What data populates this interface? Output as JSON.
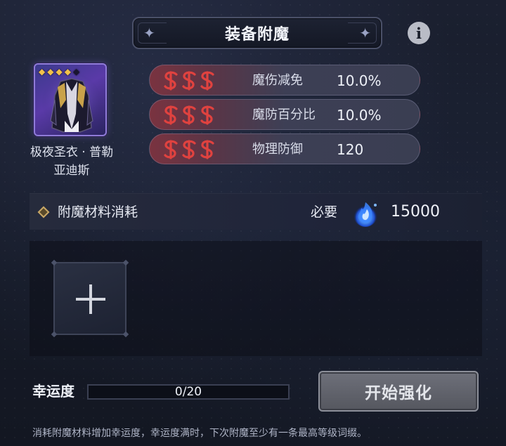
{
  "header": {
    "title": "装备附魔"
  },
  "info_button": {
    "icon": "info-icon",
    "glyph": "i"
  },
  "equipment": {
    "name_line1": "极夜圣衣 · 普勒",
    "name_line2": "亚迪斯",
    "rarity_filled": 4,
    "rarity_total": 5,
    "star_glyph": "◆"
  },
  "attributes": [
    {
      "rune_icon": "rune-s-icon",
      "name": "魔伤减免",
      "value": "10.0%"
    },
    {
      "rune_icon": "rune-s-icon",
      "name": "魔防百分比",
      "value": "10.0%"
    },
    {
      "rune_icon": "rune-s-icon",
      "name": "物理防御",
      "value": "120"
    }
  ],
  "materials": {
    "label": "附魔材料消耗",
    "required_label": "必要",
    "currency_icon": "blue-spirit-fire-icon",
    "required_amount": "15000"
  },
  "luck": {
    "label": "幸运度",
    "current": 0,
    "max": 20,
    "text": "0/20"
  },
  "start_button": {
    "label": "开始强化"
  },
  "hint": "消耗附魔材料增加幸运度，幸运度满时，下次附魔至少有一条最高等级词缀。",
  "colors": {
    "rune_red": "#e0423f",
    "star_gold": "#f2c14a",
    "accent_blue": "#3a8cff"
  }
}
